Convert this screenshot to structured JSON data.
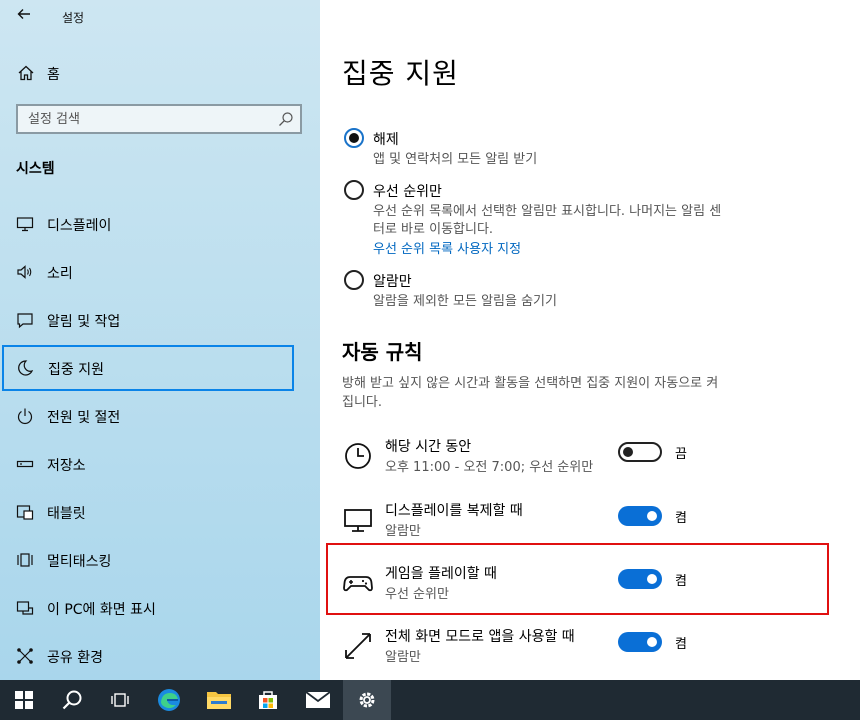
{
  "window": {
    "title": "설정"
  },
  "sidebar": {
    "home_label": "홈",
    "search_placeholder": "설정 검색",
    "section_title": "시스템",
    "items": [
      {
        "label": "디스플레이",
        "icon": "monitor-icon"
      },
      {
        "label": "소리",
        "icon": "speaker-icon"
      },
      {
        "label": "알림 및 작업",
        "icon": "notification-icon"
      },
      {
        "label": "집중 지원",
        "icon": "moon-icon",
        "selected": true
      },
      {
        "label": "전원 및 절전",
        "icon": "power-icon"
      },
      {
        "label": "저장소",
        "icon": "storage-icon"
      },
      {
        "label": "태블릿",
        "icon": "tablet-icon"
      },
      {
        "label": "멀티태스킹",
        "icon": "multitasking-icon"
      },
      {
        "label": "이 PC에 화면 표시",
        "icon": "project-icon"
      },
      {
        "label": "공유 환경",
        "icon": "share-icon"
      }
    ]
  },
  "main": {
    "title": "집중 지원",
    "options": [
      {
        "label": "해제",
        "desc": "앱 및 연락처의 모든 알림 받기",
        "checked": true
      },
      {
        "label": "우선 순위만",
        "desc_line1": "우선 순위 목록에서 선택한 알림만 표시합니다. 나머지는 알림 센",
        "desc_line2": "터로 바로 이동합니다.",
        "link": "우선 순위 목록 사용자 지정",
        "checked": false
      },
      {
        "label": "알람만",
        "desc": "알람을 제외한 모든 알림을 숨기기",
        "checked": false
      }
    ],
    "auto_rules": {
      "heading": "자동 규칙",
      "desc_line1": "방해 받고 싶지 않은 시간과 활동을 선택하면 집중 지원이 자동으로 켜",
      "desc_line2": "집니다.",
      "rules": [
        {
          "name": "해당 시간 동안",
          "sub": "오후 11:00 - 오전 7:00; 우선 순위만",
          "state": "끔",
          "on": false,
          "icon": "clock-icon"
        },
        {
          "name": "디스플레이를 복제할 때",
          "sub": "알람만",
          "state": "켬",
          "on": true,
          "icon": "monitor-icon"
        },
        {
          "name": "게임을 플레이할 때",
          "sub": "우선 순위만",
          "state": "켬",
          "on": true,
          "icon": "gamepad-icon"
        },
        {
          "name": "전체 화면 모드로 앱을 사용할 때",
          "sub": "알람만",
          "state": "켬",
          "on": true,
          "icon": "fullscreen-icon"
        }
      ]
    }
  },
  "taskbar": {
    "items": [
      "windows-start-icon",
      "search-icon",
      "task-view-icon",
      "edge-icon",
      "file-explorer-icon",
      "store-icon",
      "mail-icon",
      "settings-icon"
    ],
    "active": "settings-icon"
  },
  "colors": {
    "accent": "#0a6fd6",
    "link": "#0067c0",
    "highlight": "#e01010",
    "selection_border": "#0a84e8"
  }
}
